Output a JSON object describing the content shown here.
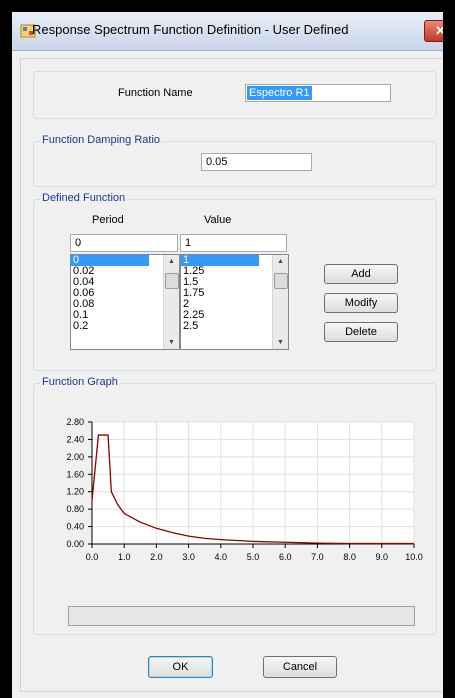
{
  "window": {
    "title": "Response Spectrum Function Definition - User Defined",
    "close_glyph": "✕"
  },
  "function_name": {
    "label": "Function Name",
    "value": "Espectro R1"
  },
  "damping": {
    "group_title": "Function Damping Ratio",
    "value": "0.05"
  },
  "defined_function": {
    "group_title": "Defined Function",
    "period_header": "Period",
    "value_header": "Value",
    "period_input": "0",
    "value_input": "1",
    "periods": [
      "0",
      "0.02",
      "0.04",
      "0.06",
      "0.08",
      "0.1",
      "0.2"
    ],
    "values": [
      "1",
      "1.25",
      "1.5",
      "1.75",
      "2",
      "2.25",
      "2.5"
    ],
    "selected_index": 0,
    "buttons": {
      "add": "Add",
      "modify": "Modify",
      "delete": "Delete"
    }
  },
  "graph": {
    "group_title": "Function Graph"
  },
  "chart_data": {
    "type": "line",
    "title": "",
    "xlabel": "",
    "ylabel": "",
    "xlim": [
      0,
      10
    ],
    "ylim": [
      0,
      2.8
    ],
    "x_ticks": [
      "0.0",
      "1.0",
      "2.0",
      "3.0",
      "4.0",
      "5.0",
      "6.0",
      "7.0",
      "8.0",
      "9.0",
      "10.0"
    ],
    "y_ticks": [
      "0.00",
      "0.40",
      "0.80",
      "1.20",
      "1.60",
      "2.00",
      "2.40",
      "2.80"
    ],
    "grid": true,
    "series_color": "#8b0000",
    "series": [
      {
        "name": "",
        "x": [
          0,
          0.2,
          0.5,
          0.6,
          0.8,
          1.0,
          1.5,
          2.0,
          2.5,
          3.0,
          3.5,
          4.0,
          5.0,
          6.0,
          7.0,
          8.0,
          9.0,
          10.0
        ],
        "y": [
          1.0,
          2.5,
          2.5,
          1.2,
          0.9,
          0.7,
          0.5,
          0.36,
          0.26,
          0.18,
          0.13,
          0.1,
          0.06,
          0.04,
          0.02,
          0.01,
          0.01,
          0.01
        ]
      }
    ]
  },
  "footer": {
    "ok": "OK",
    "cancel": "Cancel"
  }
}
